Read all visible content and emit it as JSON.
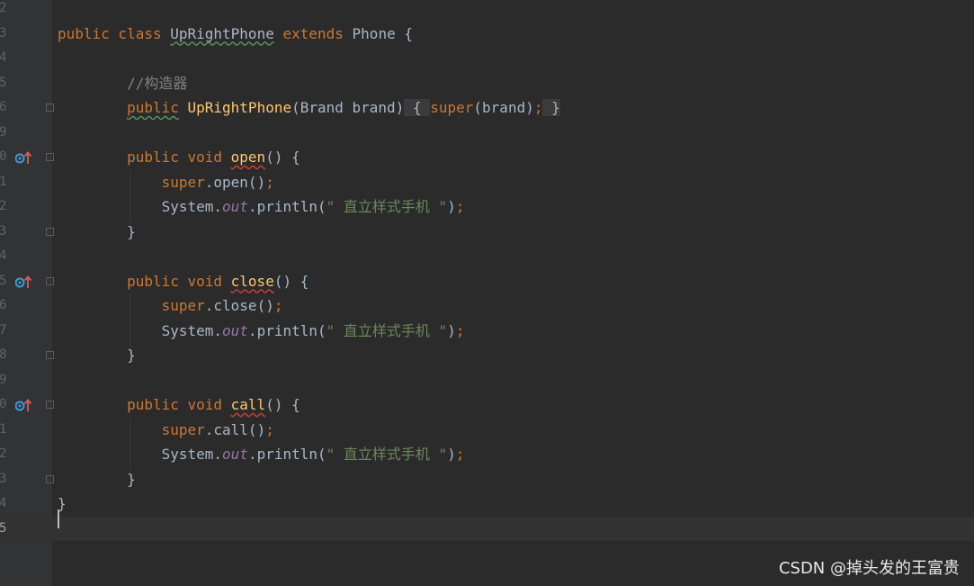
{
  "lines": [
    {
      "num": "2",
      "tokens": []
    },
    {
      "num": "3",
      "tokens": [
        {
          "t": "public class ",
          "c": "kw"
        },
        {
          "t": "UpRightPhone",
          "c": "sq"
        },
        {
          "t": " "
        },
        {
          "t": "extends",
          "c": "kw"
        },
        {
          "t": " Phone {"
        }
      ]
    },
    {
      "num": "4",
      "tokens": []
    },
    {
      "num": "5",
      "tokens": [
        {
          "t": "        //构造器",
          "c": "cm"
        }
      ]
    },
    {
      "num": "6",
      "tokens": [
        {
          "t": "        "
        },
        {
          "t": "public",
          "c": "kw sq"
        },
        {
          "t": " "
        },
        {
          "t": "UpRightPhone",
          "c": "fn"
        },
        {
          "t": "(Brand brand)"
        },
        {
          "t": " { ",
          "c": "fold-bg"
        },
        {
          "t": "super",
          "c": "kw"
        },
        {
          "t": "(brand)"
        },
        {
          "t": ";",
          "c": "kw"
        },
        {
          "t": " }",
          "c": "fold-bg"
        }
      ]
    },
    {
      "num": "9",
      "tokens": []
    },
    {
      "num": "0",
      "tokens": [
        {
          "t": "        "
        },
        {
          "t": "public void ",
          "c": "kw"
        },
        {
          "t": "open",
          "c": "fn sq-red"
        },
        {
          "t": "() {"
        }
      ]
    },
    {
      "num": "1",
      "tokens": [
        {
          "t": "            "
        },
        {
          "t": "super",
          "c": "kw"
        },
        {
          "t": ".open()"
        },
        {
          "t": ";",
          "c": "kw"
        }
      ]
    },
    {
      "num": "2",
      "tokens": [
        {
          "t": "            System."
        },
        {
          "t": "out",
          "c": "field"
        },
        {
          "t": ".println("
        },
        {
          "t": "\" 直立样式手机 \"",
          "c": "str"
        },
        {
          "t": ")"
        },
        {
          "t": ";",
          "c": "kw"
        }
      ]
    },
    {
      "num": "3",
      "tokens": [
        {
          "t": "        }"
        }
      ]
    },
    {
      "num": "4",
      "tokens": []
    },
    {
      "num": "5",
      "tokens": [
        {
          "t": "        "
        },
        {
          "t": "public void ",
          "c": "kw"
        },
        {
          "t": "close",
          "c": "fn sq-red"
        },
        {
          "t": "() {"
        }
      ]
    },
    {
      "num": "6",
      "tokens": [
        {
          "t": "            "
        },
        {
          "t": "super",
          "c": "kw"
        },
        {
          "t": ".close()"
        },
        {
          "t": ";",
          "c": "kw"
        }
      ]
    },
    {
      "num": "7",
      "tokens": [
        {
          "t": "            System."
        },
        {
          "t": "out",
          "c": "field"
        },
        {
          "t": ".println("
        },
        {
          "t": "\" 直立样式手机 \"",
          "c": "str"
        },
        {
          "t": ")"
        },
        {
          "t": ";",
          "c": "kw"
        }
      ]
    },
    {
      "num": "8",
      "tokens": [
        {
          "t": "        }"
        }
      ]
    },
    {
      "num": "9",
      "tokens": []
    },
    {
      "num": "0",
      "tokens": [
        {
          "t": "        "
        },
        {
          "t": "public void ",
          "c": "kw"
        },
        {
          "t": "call",
          "c": "fn sq-red"
        },
        {
          "t": "() {"
        }
      ]
    },
    {
      "num": "1",
      "tokens": [
        {
          "t": "            "
        },
        {
          "t": "super",
          "c": "kw"
        },
        {
          "t": ".call()"
        },
        {
          "t": ";",
          "c": "kw"
        }
      ]
    },
    {
      "num": "2",
      "tokens": [
        {
          "t": "            System."
        },
        {
          "t": "out",
          "c": "field"
        },
        {
          "t": ".println("
        },
        {
          "t": "\" 直立样式手机 \"",
          "c": "str"
        },
        {
          "t": ")"
        },
        {
          "t": ";",
          "c": "kw"
        }
      ]
    },
    {
      "num": "3",
      "tokens": [
        {
          "t": "        }"
        }
      ]
    },
    {
      "num": "4",
      "tokens": [
        {
          "t": "}"
        }
      ]
    },
    {
      "num": "5",
      "tokens": [],
      "current": true
    }
  ],
  "override_icons": [
    "override-icon",
    "override-icon",
    "override-icon"
  ],
  "watermark": "CSDN @掉头发的王富贵",
  "colors": {
    "background": "#2b2b2b",
    "keyword": "#cc7832",
    "function": "#ffc66d",
    "string": "#6a8759",
    "comment": "#808080",
    "field": "#9876aa",
    "text": "#a9b7c6"
  }
}
